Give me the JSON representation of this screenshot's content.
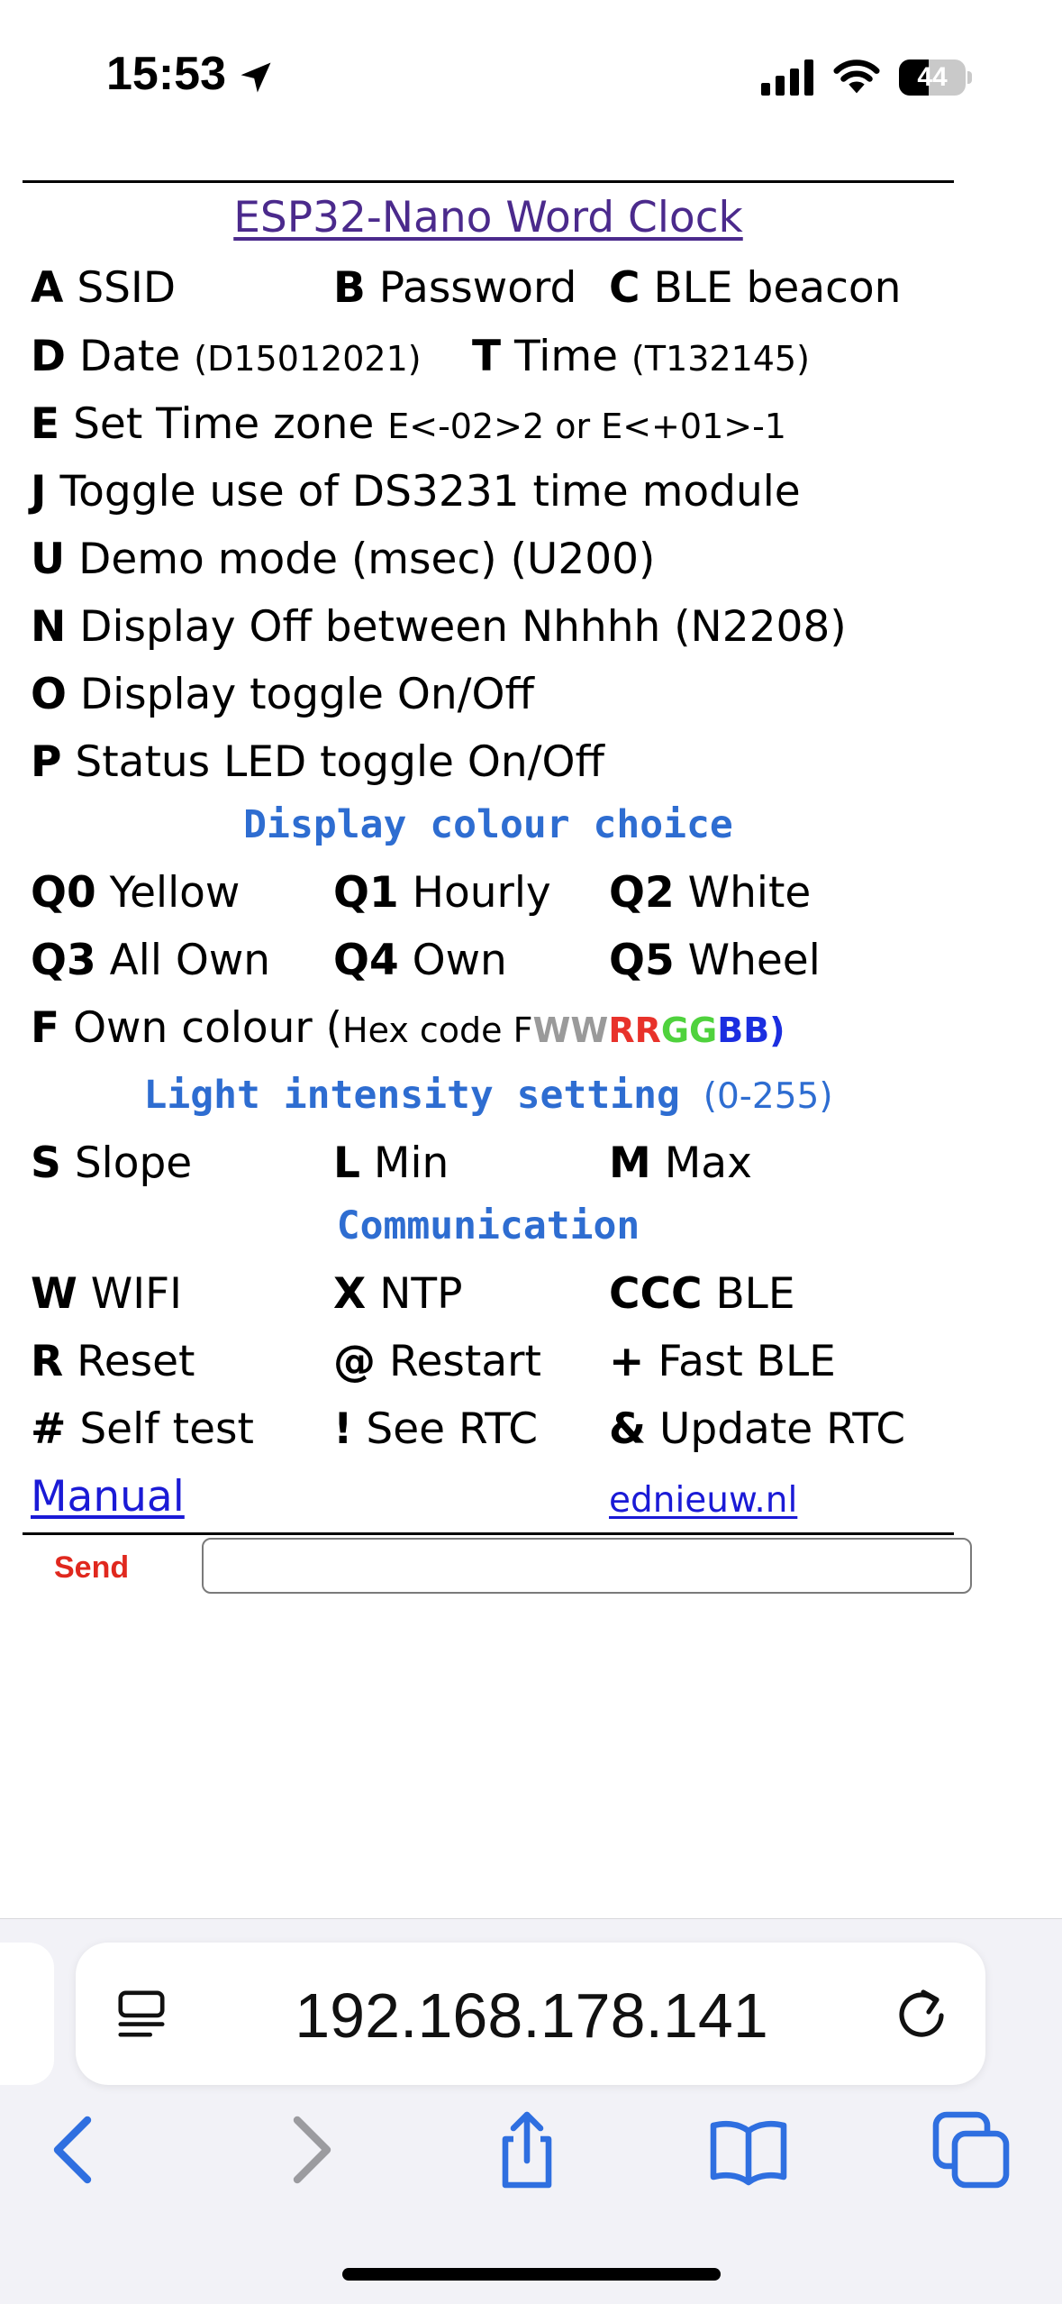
{
  "status_bar": {
    "time": "15:53",
    "battery_level": "44",
    "battery_fraction": 0.44
  },
  "page": {
    "title": "ESP32-Nano Word Clock",
    "rows": [
      {
        "k1": "A",
        "t1": "SSID",
        "k2": "B",
        "t2": "Password",
        "k3": "C",
        "t3": "BLE beacon"
      },
      {
        "k1": "D",
        "t1": "Date",
        "n1": "(D15012021)",
        "k2": "T",
        "t2": "Time",
        "n2": "(T132145)"
      },
      {
        "k1": "E",
        "t1": "Set Time zone",
        "n1": "E<-02>2 or E<+01>-1"
      },
      {
        "k1": "J",
        "t1": "Toggle use of DS3231 time module"
      },
      {
        "k1": "U",
        "t1": "Demo mode (msec) (U200)"
      },
      {
        "k1": "N",
        "t1": "Display Off between Nhhhh (N2208)"
      },
      {
        "k1": "O",
        "t1": "Display toggle On/Off"
      },
      {
        "k1": "P",
        "t1": "Status LED toggle On/Off"
      }
    ],
    "section_colour": "Display colour choice",
    "colour_rows": [
      {
        "k1": "Q0",
        "t1": "Yellow",
        "k2": "Q1",
        "t2": "Hourly",
        "k3": "Q2",
        "t3": "White"
      },
      {
        "k1": "Q3",
        "t1": "All Own",
        "k2": "Q4",
        "t2": "Own",
        "k3": "Q5",
        "t3": "Wheel"
      }
    ],
    "own_colour": {
      "key": "F",
      "text": "Own colour (",
      "hex_prefix": "Hex code F",
      "ww": "WW",
      "rr": "RR",
      "gg": "GG",
      "bb": "BB",
      "close": ")"
    },
    "section_light": "Light intensity setting",
    "section_light_note": "(0-255)",
    "light_row": {
      "k1": "S",
      "t1": "Slope",
      "k2": "L",
      "t2": "Min",
      "k3": "M",
      "t3": "Max"
    },
    "section_comm": "Communication",
    "comm_rows": [
      {
        "k1": "W",
        "t1": "WIFI",
        "k2": "X",
        "t2": "NTP",
        "k3": "CCC",
        "t3": "BLE"
      },
      {
        "k1": "R",
        "t1": "Reset",
        "k2": "@",
        "t2": "Restart",
        "k3": "+",
        "t3": "Fast BLE"
      },
      {
        "k1": "#",
        "t1": "Self test",
        "k2": "!",
        "t2": "See RTC",
        "k3": "&",
        "t3": "Update RTC"
      }
    ],
    "manual_link": "Manual",
    "site_link": "ednieuw.nl",
    "send_label": "Send",
    "send_value": ""
  },
  "browser": {
    "url": "192.168.178.141",
    "icons": [
      "reader-icon",
      "reload-icon",
      "back-icon",
      "forward-icon",
      "share-icon",
      "bookmarks-icon",
      "tabs-icon"
    ]
  },
  "colors": {
    "title": "#4b2a8c",
    "section": "#2e6dd1",
    "link": "#1a1ad6",
    "send": "#e0281e",
    "accent": "#2f6fe0"
  }
}
